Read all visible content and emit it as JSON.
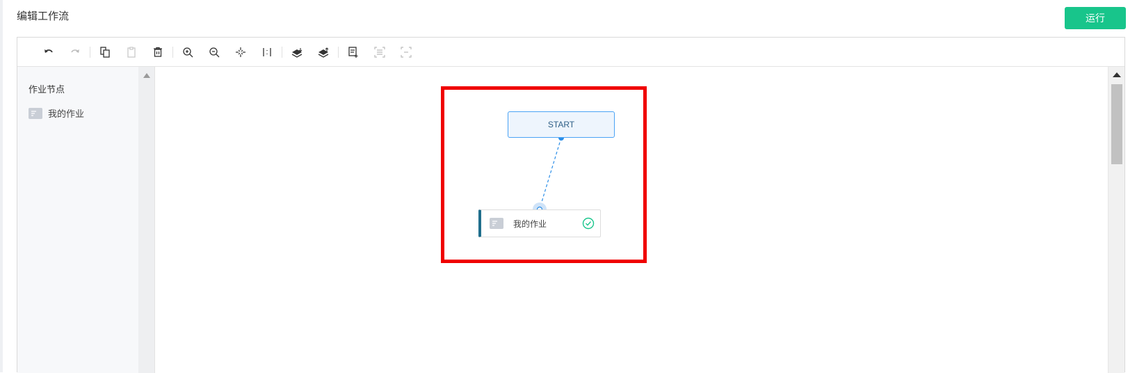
{
  "header": {
    "title": "编辑工作流",
    "run_label": "运行"
  },
  "toolbar": {
    "buttons": [
      "undo",
      "redo",
      "copy",
      "paste",
      "delete",
      "zoom-in",
      "zoom-out",
      "fit",
      "align",
      "import",
      "export",
      "select-add",
      "select-all",
      "select-clear"
    ]
  },
  "sidebar": {
    "title": "作业节点",
    "items": [
      {
        "label": "我的作业",
        "icon": "job-node-icon"
      }
    ]
  },
  "canvas": {
    "start_node": {
      "label": "START"
    },
    "job_node": {
      "label": "我的作业",
      "status": "success-check-icon"
    }
  },
  "colors": {
    "accent": "#18c58b",
    "highlight": "#f00000",
    "edge": "#2b8ee8"
  }
}
